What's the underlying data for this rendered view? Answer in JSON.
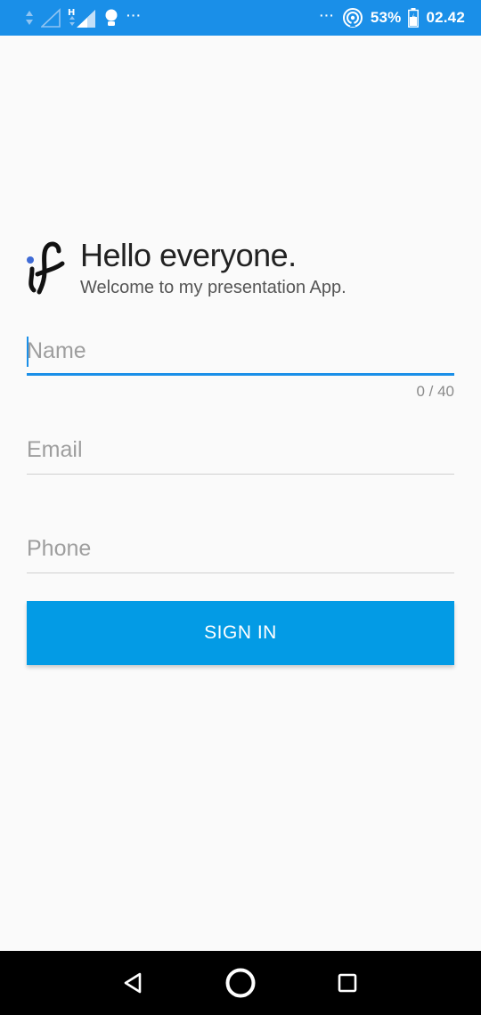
{
  "status_bar": {
    "left_dots": "···",
    "right_dots": "···",
    "battery_percent": "53%",
    "time": "02.42"
  },
  "header": {
    "title": "Hello everyone.",
    "subtitle": "Welcome to my presentation App."
  },
  "form": {
    "name": {
      "placeholder": "Name",
      "value": "",
      "counter": "0 / 40"
    },
    "email": {
      "placeholder": "Email",
      "value": ""
    },
    "phone": {
      "placeholder": "Phone",
      "value": ""
    },
    "sign_in_label": "SIGN IN"
  },
  "colors": {
    "accent": "#1a8fe8",
    "button": "#039be5",
    "logo_dot": "#3f6bd6"
  },
  "icons": {
    "status_left": [
      "data-arrows-icon",
      "signal-icon",
      "signal-h-icon",
      "notification-icon"
    ],
    "status_right": [
      "hotspot-icon",
      "battery-icon"
    ],
    "nav": [
      "back-icon",
      "home-icon",
      "recents-icon"
    ]
  }
}
